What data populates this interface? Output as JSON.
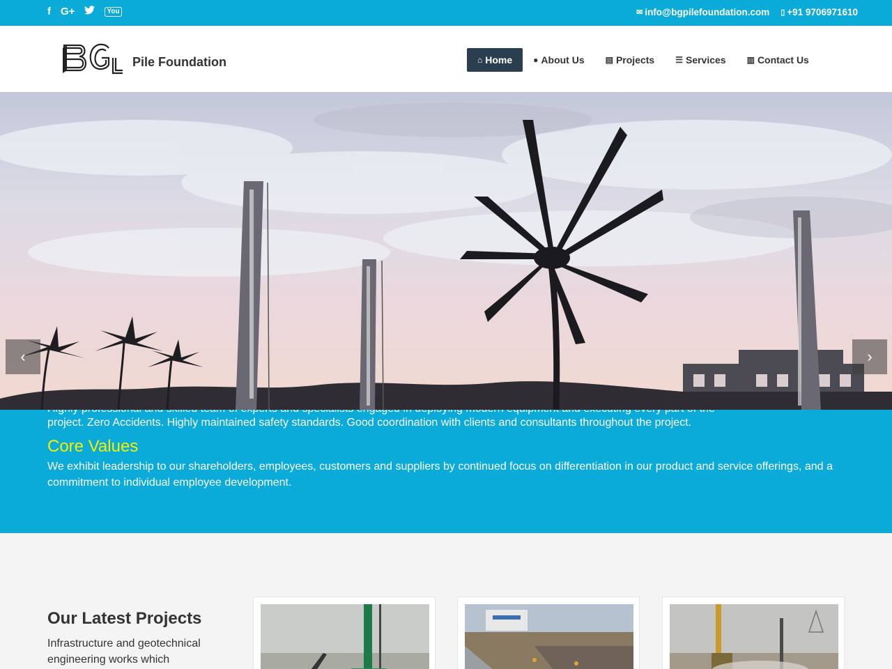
{
  "topbar": {
    "social": [
      {
        "icon": "facebook-icon",
        "glyph": "f"
      },
      {
        "icon": "google-plus-icon",
        "glyph": "G+"
      },
      {
        "icon": "twitter-icon",
        "glyph": "t"
      },
      {
        "icon": "youtube-icon",
        "glyph": "You"
      }
    ],
    "email": "info@bgpilefoundation.com",
    "phone": "+91 9706971610"
  },
  "header": {
    "brand": "Pile Foundation",
    "nav": [
      {
        "label": "Home",
        "icon": "home-icon",
        "active": true
      },
      {
        "label": "About Us",
        "icon": "globe-icon",
        "active": false
      },
      {
        "label": "Projects",
        "icon": "newspaper-icon",
        "active": false
      },
      {
        "label": "Services",
        "icon": "list-icon",
        "active": false
      },
      {
        "label": "Contact Us",
        "icon": "map-icon",
        "active": false
      }
    ]
  },
  "hero": {
    "prev_icon": "chevron-left-icon",
    "next_icon": "chevron-right-icon"
  },
  "band": {
    "cut_text": "Highly professional and skilled team of experts and specialists engaged in deploying modern equipment and executing every part of the",
    "paragraph1": "project. Zero Accidents. Highly maintained safety standards. Good coordination with clients and consultants throughout the project.",
    "core_values_title": "Core Values",
    "core_values_text": "We exhibit leadership to our shareholders, employees, customers and suppliers by continued focus on differentiation in our product and service offerings, and a commitment to individual employee development."
  },
  "projects": {
    "title": "Our Latest Projects",
    "description": "Infrastructure and geotechnical engineering works which"
  },
  "colors": {
    "accent": "#0aaad9",
    "nav_active": "#2b3e50",
    "highlight": "#f4f000"
  }
}
